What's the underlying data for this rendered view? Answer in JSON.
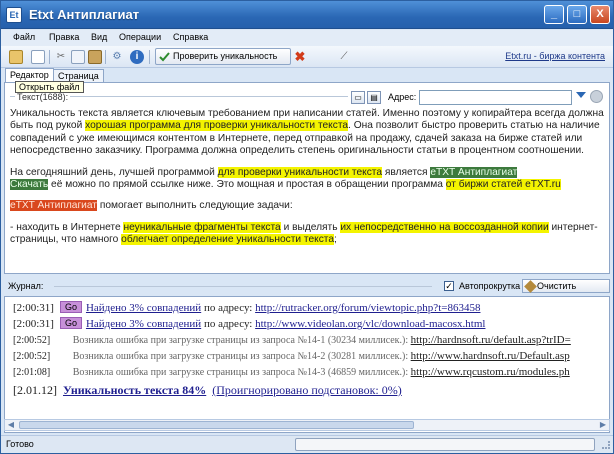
{
  "window": {
    "title": "Etxt Антиплагиат",
    "app_icon": "Et",
    "controls": {
      "minimize": "_",
      "maximize": "□",
      "close": "X"
    }
  },
  "menu": [
    "Файл",
    "Правка",
    "Вид",
    "Операции",
    "Справка"
  ],
  "toolbar": {
    "check_button": "Проверить уникальность",
    "link": "Etxt.ru - биржа контента",
    "icons": [
      "open-icon",
      "new-icon",
      "cut-icon",
      "copy-icon",
      "paste-icon",
      "settings-icon",
      "info-icon",
      "check-icon",
      "cancel-icon",
      "magic-wand-icon"
    ]
  },
  "tabs": [
    {
      "label": "Редактор",
      "active": true
    },
    {
      "label": "Страница",
      "active": false
    }
  ],
  "tooltip": "Открыть файл",
  "editor": {
    "group_label": "Текст(1688):",
    "address_label": "Адрес:",
    "address_value": "",
    "p1": {
      "t1": "Уникальность текста является ключевым требованием при написании статей. Именно поэтому у копирайтера всегда должна быть под рукой ",
      "h1": "хорошая программа для проверки уникальности текста",
      "t2": ". Она позволит быстро проверить статью на наличие совпадений с уже имеющимся контентом в Интернете, перед отправкой на продажу, сдачей заказа на бирже статей или непосредственно заказчику. Программа должна определить степень оригинальности статьи в процентном соотношении."
    },
    "p2": {
      "t1": "На сегодняшний день, лучшей программой ",
      "h1": "для проверки уникальности текста",
      "t2": " является ",
      "g1": "eTXT Антиплагиат",
      "nl": " ",
      "g2": "Скачать",
      "t3": " её можно по прямой ссылке ниже. Это мощная и простая в обращении программа ",
      "h2": "от биржи статей eTXT.ru"
    },
    "p3": {
      "o1": "eTXT Антиплагиат",
      "t1": " помогает выполнить следующие задачи:"
    },
    "p4": {
      "t1": "- находить в Интернете ",
      "h1": "неуникальные фрагменты текста",
      "t2": " и выделять ",
      "h2": "их непосредственно на воссозданной копии",
      "t3": " интернет-страницы, что намного ",
      "h3": "облегчает определение уникальности текста",
      "t4": ";"
    }
  },
  "journal": {
    "label": "Журнал:",
    "autoscroll_label": "Автопрокрутка",
    "autoscroll_checked": true,
    "clear_button": "Очистить журнал",
    "rows": [
      {
        "time": "[2:00:31]",
        "badge": "Go",
        "link": "Найдено 3% совпадений",
        "text": " по адресу: ",
        "url": "http://rutracker.org/forum/viewtopic.php?t=863458"
      },
      {
        "time": "[2:00:31]",
        "badge": "Go",
        "link": "Найдено 3% совпадений",
        "text": " по адресу: ",
        "url": "http://www.videolan.org/vlc/download-macosx.html"
      }
    ],
    "errors": [
      {
        "time": "[2:00:52]",
        "text": "Возникла ошибка при загрузке страницы из запроса №14-1 (30234 миллисек.): ",
        "url": "http://hardnsoft.ru/default.asp?trID="
      },
      {
        "time": "[2:00:52]",
        "text": "Возникла ошибка при загрузке страницы из запроса №14-2 (30281 миллисек.): ",
        "url": "http://www.hardnsoft.ru/Default.asp"
      },
      {
        "time": "[2:01:08]",
        "text": "Возникла ошибка при загрузке страницы из запроса №14-3 (46859 миллисек.): ",
        "url": "http://www.rqcustom.ru/modules.ph"
      }
    ],
    "final": {
      "time": "[2.01.12]",
      "uniqueness": "Уникальность текста 84%",
      "ignored": "(Проигнорировано подстановок: 0%)"
    }
  },
  "status": {
    "text": "Готово",
    "progress": 0
  }
}
